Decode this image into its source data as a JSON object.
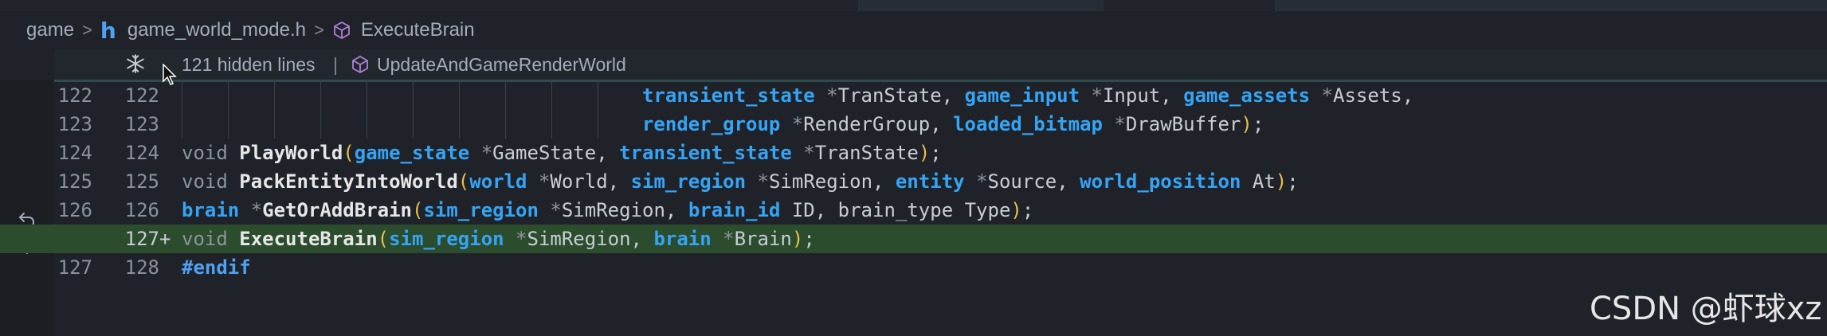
{
  "breadcrumb": {
    "items": [
      {
        "label": "game",
        "icon": ""
      },
      {
        "label": "game_world_mode.h",
        "icon": "h-file-icon"
      },
      {
        "label": "ExecuteBrain",
        "icon": "cube-icon"
      }
    ],
    "h_glyph": "h"
  },
  "sticky": {
    "hidden_text": "121 hidden lines",
    "separator": "|",
    "symbol": "UpdateAndGameRenderWorld"
  },
  "colors": {
    "added_bg": "#2b4c2d",
    "type": "#35a4f5",
    "paren": "#e5c04a"
  },
  "code_lines": [
    {
      "ln_orig": "122",
      "ln_mod": "122",
      "marker": "",
      "tokens": [
        {
          "t": "                                        ",
          "c": "pl"
        },
        {
          "t": "transient_state",
          "c": "ty"
        },
        {
          "t": " *",
          "c": "kw"
        },
        {
          "t": "TranState, ",
          "c": "pl"
        },
        {
          "t": "game_input",
          "c": "ty"
        },
        {
          "t": " *",
          "c": "kw"
        },
        {
          "t": "Input, ",
          "c": "pl"
        },
        {
          "t": "game_assets",
          "c": "ty"
        },
        {
          "t": " *",
          "c": "kw"
        },
        {
          "t": "Assets,",
          "c": "pl"
        }
      ]
    },
    {
      "ln_orig": "123",
      "ln_mod": "123",
      "marker": "",
      "tokens": [
        {
          "t": "                                        ",
          "c": "pl"
        },
        {
          "t": "render_group",
          "c": "ty"
        },
        {
          "t": " *",
          "c": "kw"
        },
        {
          "t": "RenderGroup, ",
          "c": "pl"
        },
        {
          "t": "loaded_bitmap",
          "c": "ty"
        },
        {
          "t": " *",
          "c": "kw"
        },
        {
          "t": "DrawBuffer",
          "c": "pl"
        },
        {
          "t": ")",
          "c": "pa"
        },
        {
          "t": ";",
          "c": "pl"
        }
      ]
    },
    {
      "ln_orig": "124",
      "ln_mod": "124",
      "marker": "",
      "tokens": [
        {
          "t": "void ",
          "c": "kw"
        },
        {
          "t": "PlayWorld",
          "c": "fn"
        },
        {
          "t": "(",
          "c": "pa"
        },
        {
          "t": "game_state",
          "c": "ty"
        },
        {
          "t": " *",
          "c": "kw"
        },
        {
          "t": "GameState, ",
          "c": "pl"
        },
        {
          "t": "transient_state",
          "c": "ty"
        },
        {
          "t": " *",
          "c": "kw"
        },
        {
          "t": "TranState",
          "c": "pl"
        },
        {
          "t": ")",
          "c": "pa"
        },
        {
          "t": ";",
          "c": "pl"
        }
      ]
    },
    {
      "ln_orig": "125",
      "ln_mod": "125",
      "marker": "",
      "tokens": [
        {
          "t": "void ",
          "c": "kw"
        },
        {
          "t": "PackEntityIntoWorld",
          "c": "fn"
        },
        {
          "t": "(",
          "c": "pa"
        },
        {
          "t": "world",
          "c": "ty"
        },
        {
          "t": " *",
          "c": "kw"
        },
        {
          "t": "World, ",
          "c": "pl"
        },
        {
          "t": "sim_region",
          "c": "ty"
        },
        {
          "t": " *",
          "c": "kw"
        },
        {
          "t": "SimRegion, ",
          "c": "pl"
        },
        {
          "t": "entity",
          "c": "ty"
        },
        {
          "t": " *",
          "c": "kw"
        },
        {
          "t": "Source, ",
          "c": "pl"
        },
        {
          "t": "world_position",
          "c": "ty"
        },
        {
          "t": " At",
          "c": "pl"
        },
        {
          "t": ")",
          "c": "pa"
        },
        {
          "t": ";",
          "c": "pl"
        }
      ]
    },
    {
      "ln_orig": "126",
      "ln_mod": "126",
      "marker": "",
      "tokens": [
        {
          "t": "brain",
          "c": "ty"
        },
        {
          "t": " *",
          "c": "kw"
        },
        {
          "t": "GetOrAddBrain",
          "c": "fn"
        },
        {
          "t": "(",
          "c": "pa"
        },
        {
          "t": "sim_region",
          "c": "ty"
        },
        {
          "t": " *",
          "c": "kw"
        },
        {
          "t": "SimRegion, ",
          "c": "pl"
        },
        {
          "t": "brain_id",
          "c": "ty"
        },
        {
          "t": " ID, brain_type Type",
          "c": "pl"
        },
        {
          "t": ")",
          "c": "pa"
        },
        {
          "t": ";",
          "c": "pl"
        }
      ]
    },
    {
      "ln_orig": "",
      "ln_mod": "127",
      "marker": "+",
      "added": true,
      "tokens": [
        {
          "t": "void ",
          "c": "kw"
        },
        {
          "t": "ExecuteBrain",
          "c": "fn"
        },
        {
          "t": "(",
          "c": "pa"
        },
        {
          "t": "sim_region",
          "c": "ty"
        },
        {
          "t": " *",
          "c": "kw"
        },
        {
          "t": "SimRegion, ",
          "c": "pl"
        },
        {
          "t": "brain",
          "c": "ty"
        },
        {
          "t": " *",
          "c": "kw"
        },
        {
          "t": "Brain",
          "c": "pl"
        },
        {
          "t": ")",
          "c": "pa"
        },
        {
          "t": ";",
          "c": "pl"
        }
      ]
    },
    {
      "ln_orig": "127",
      "ln_mod": "128",
      "marker": "",
      "tokens": [
        {
          "t": "#endif",
          "c": "pp"
        }
      ]
    }
  ],
  "watermark": "CSDN @虾球xz"
}
